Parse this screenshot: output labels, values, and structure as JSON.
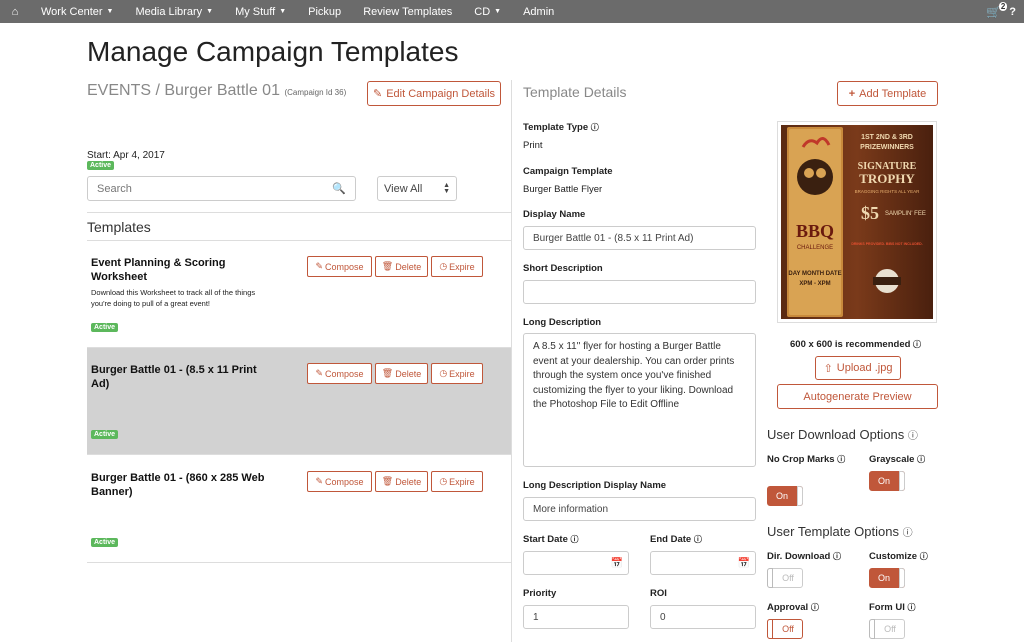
{
  "nav": {
    "home_icon": "home-icon",
    "items": [
      {
        "label": "Work Center",
        "caret": true
      },
      {
        "label": "Media Library",
        "caret": true
      },
      {
        "label": "My Stuff",
        "caret": true
      },
      {
        "label": "Pickup",
        "caret": false
      },
      {
        "label": "Review Templates",
        "caret": false
      },
      {
        "label": "CD",
        "caret": true
      },
      {
        "label": "Admin",
        "caret": false
      }
    ],
    "cart_count": "2",
    "help": "?"
  },
  "page_title": "Manage Campaign Templates",
  "campaign": {
    "name": "EVENTS / Burger Battle 01",
    "id_label": "(Campaign Id 36)",
    "edit_label": "Edit Campaign Details",
    "start": "Start: Apr 4, 2017",
    "status": "Active"
  },
  "search": {
    "placeholder": "Search"
  },
  "view": {
    "selected": "View All"
  },
  "templates_heading": "Templates",
  "row_buttons": {
    "compose": "Compose",
    "delete": "Delete",
    "expire": "Expire"
  },
  "templates": [
    {
      "title": "Event Planning & Scoring Worksheet",
      "desc": "Download this Worksheet to track all of the things you're doing to pull of a great event!",
      "status": "Active"
    },
    {
      "title": "Burger Battle 01 - (8.5 x 11 Print Ad)",
      "desc": "",
      "status": "Active"
    },
    {
      "title": "Burger Battle 01 - (860 x 285 Web Banner)",
      "desc": "",
      "status": "Active"
    }
  ],
  "details": {
    "heading": "Template Details",
    "add_label": "Add Template",
    "type_label": "Template Type",
    "type_value": "Print",
    "campaign_template_label": "Campaign Template",
    "campaign_template_value": "Burger Battle Flyer",
    "display_name_label": "Display Name",
    "display_name_value": "Burger Battle 01 - (8.5 x 11 Print Ad)",
    "short_desc_label": "Short Description",
    "short_desc_value": "",
    "long_desc_label": "Long Description",
    "long_desc_value": "A 8.5 x 11\" flyer for hosting a Burger Battle event at your dealership. You can order prints through the system once you've finished customizing the flyer to your liking. Download the Photoshop File to Edit Offline",
    "long_desc_display_label": "Long Description Display Name",
    "long_desc_display_value": "More information",
    "start_date_label": "Start Date",
    "end_date_label": "End Date",
    "priority_label": "Priority",
    "priority_value": "1",
    "roi_label": "ROI",
    "roi_value": "0"
  },
  "preview": {
    "lines": [
      "1ST 2ND & 3RD",
      "PRIZEWINNERS",
      "SIGNATURE",
      "TROPHY",
      "BRAGGING RIGHTS ALL YEAR",
      "$5",
      "SAMPLIN' FEE",
      "DRINKS PROVIDED. BIBS NOT INCLUDED.",
      "BBQ",
      "CHALLENGE",
      "DAY MONTH DATE",
      "XPM - XPM"
    ],
    "recommended": "600 x 600 is recommended",
    "upload_label": "Upload .jpg",
    "autogen_label": "Autogenerate Preview"
  },
  "download_options": {
    "heading": "User Download Options",
    "no_crop_label": "No Crop Marks",
    "no_crop_value": "On",
    "grayscale_label": "Grayscale",
    "grayscale_value": "On"
  },
  "template_options": {
    "heading": "User Template Options",
    "dir_download_label": "Dir. Download",
    "dir_download_value": "Off",
    "customize_label": "Customize",
    "customize_value": "On",
    "approval_label": "Approval",
    "approval_value": "Off",
    "form_ui_label": "Form UI",
    "form_ui_value": "Off"
  },
  "colors": {
    "accent": "#c0573a",
    "active": "#5cb85c",
    "nav": "#6b6b6b",
    "selected_row": "#d2d2d2"
  }
}
